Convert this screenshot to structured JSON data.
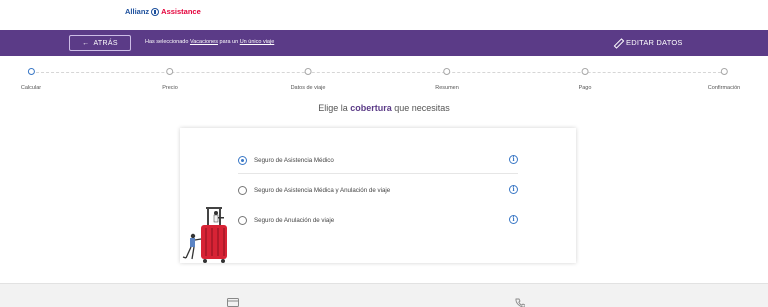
{
  "brand": {
    "name_part1": "Allianz",
    "name_part2": "Assistance",
    "logo_icon": "allianz-eagle-icon"
  },
  "header": {
    "back_label": "ATRÁS",
    "back_icon": "arrow-left-icon",
    "selection_prefix": "Has seleccionado",
    "selection_trip": "Vacaciones",
    "selection_mid": "para un",
    "selection_mode": "Un único viaje",
    "edit_label": "EDITAR DATOS",
    "edit_icon": "pencil-icon"
  },
  "stepper": {
    "active_index": 0,
    "steps": [
      {
        "label": "Calcular"
      },
      {
        "label": "Precio"
      },
      {
        "label": "Datos de viaje"
      },
      {
        "label": "Resumen"
      },
      {
        "label": "Pago"
      },
      {
        "label": "Confirmación"
      }
    ]
  },
  "headline": {
    "prefix": "Elige la",
    "highlight": "cobertura",
    "suffix": "que necesitas"
  },
  "coverage": {
    "selected_index": 0,
    "options": [
      {
        "label": "Seguro de Asistencia Médico"
      },
      {
        "label": "Seguro de Asistencia Médica y Anulación de viaje"
      },
      {
        "label": "Seguro de Anulación de viaje"
      }
    ],
    "info_icon": "info-icon",
    "illustration": "suitcase-traveler-illustration"
  },
  "footer": {
    "icons": [
      "card-icon",
      "phone-icon"
    ]
  },
  "colors": {
    "brand_purple": "#5b3b87",
    "accent_blue": "#3a78c6",
    "suitcase_red": "#d72335"
  }
}
